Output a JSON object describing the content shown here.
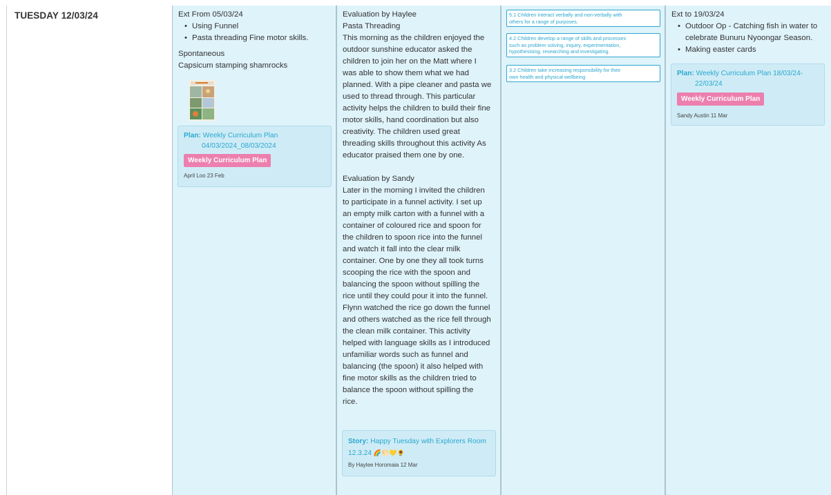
{
  "day": {
    "title": "TUESDAY 12/03/24"
  },
  "col1": {
    "heading": "Ext From 05/03/24",
    "bullets": [
      "Using Funnel",
      "Pasta threading Fine motor skills."
    ],
    "line1": "Spontaneous",
    "line2": "Capsicum stamping shamrocks",
    "plan": {
      "label": "Plan:",
      "value_line1": "Weekly Curriculum Plan",
      "value_line2": "04/03/2024_08/03/2024",
      "button": "Weekly Curriculum Plan",
      "meta": "April Loo 23 Feb"
    }
  },
  "col2": {
    "eval1": {
      "heading": "Evaluation by Haylee",
      "subheading": "Pasta Threading",
      "lines": [
        "This morning as the children enjoyed the",
        "outdoor sunshine educator asked the",
        "children to join her on the Matt where I",
        "was able to show them what we had",
        "planned. With a pipe cleaner and pasta we",
        "used to thread through. This particular",
        "activity helps the children to build their fine",
        "motor skills, hand coordination but also",
        "creativity. The children used great",
        "threading skills throughout this activity As",
        "educator praised them one by one."
      ]
    },
    "eval2": {
      "heading": "Evaluation by Sandy",
      "lines": [
        "Later in the morning I invited the children",
        "to participate in a funnel activity. I set up",
        "an empty milk carton with a funnel with a",
        "container of coloured rice and spoon for",
        "the children to spoon rice into the funnel",
        "and watch it fall into the clear milk",
        "container. One by one they all took turns",
        "scooping the rice with the spoon and",
        "balancing the spoon without spilling the",
        "rice until they could pour it into the funnel.",
        "Flynn watched the rice go down the funnel",
        "and others watched as the rice fell through",
        "the clean milk container. This activity",
        "helped with language skills as I introduced",
        "unfamiliar words such as funnel and",
        "balancing (the spoon) it also helped with",
        "fine motor skills as the children tried to",
        "balance the spoon without spilling the",
        "rice."
      ]
    },
    "story": {
      "label": "Story:",
      "value_line1": "Happy Tuesday with Explorers Room",
      "value_line2": "12.3.24",
      "emoji": "🌈🌕💛🌻",
      "meta": "By Haylee Horomaia 12 Mar"
    }
  },
  "col3": {
    "outcomes": [
      {
        "line1": "5.1 Children interact verbally and non-verbally with",
        "line2": "others for a range of purposes."
      },
      {
        "line1": "4.2 Children develop a range of skills and processes",
        "line2": "such as problem solving, inquiry, experimentation,",
        "line3": "hypothesising, researching and investigating."
      },
      {
        "line1": "3.2 Children take increasing responsibility for their",
        "line2": "own health and physical wellbeing"
      }
    ]
  },
  "col4": {
    "heading": "Ext to 19/03/24",
    "bullets": [
      {
        "line1": "Outdoor Op - Catching fish in water to",
        "line2": "celebrate Bunuru Nyoongar Season."
      },
      {
        "line1": "Making easter cards"
      }
    ],
    "plan": {
      "label": "Plan:",
      "value_line1": "Weekly Curriculum Plan 18/03/24-",
      "value_line2": "22/03/24",
      "button": "Weekly Curriculum Plan",
      "meta": "Sandy Austin 11 Mar"
    }
  },
  "colors": {
    "column_bg": "#dff3fa",
    "card_bg": "#cfecf6",
    "link": "#2aa7cf",
    "button": "#ec7fae"
  }
}
